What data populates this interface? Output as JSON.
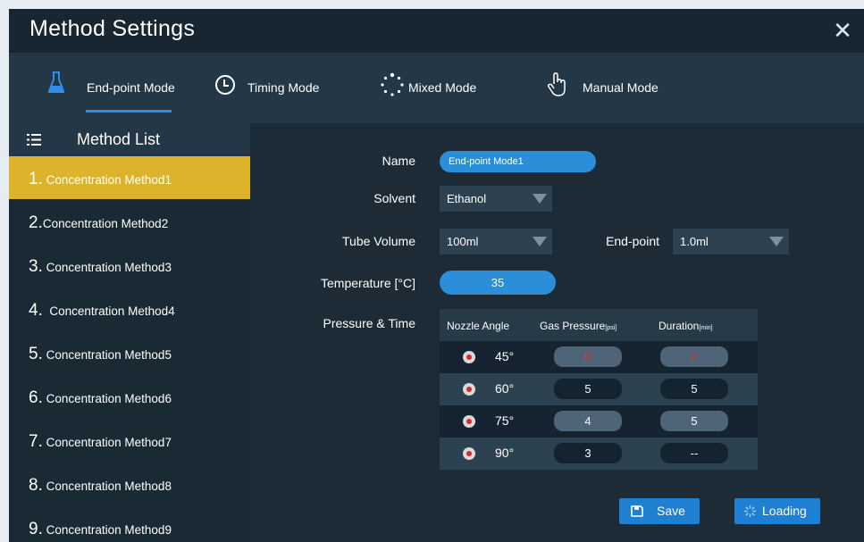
{
  "window": {
    "title": "Method Settings"
  },
  "modes": [
    {
      "label": "End-point Mode",
      "icon": "flask-icon",
      "active": true
    },
    {
      "label": "Timing Mode",
      "icon": "clock-icon",
      "active": false
    },
    {
      "label": "Mixed Mode",
      "icon": "dotted-circle-icon",
      "active": false
    },
    {
      "label": "Manual Mode",
      "icon": "hand-pointer-icon",
      "active": false
    }
  ],
  "sidebar": {
    "title": "Method List",
    "items": [
      {
        "num": "1.",
        "label": " Concentration Method1",
        "active": true
      },
      {
        "num": "2.",
        "label": "Concentration Method2",
        "active": false
      },
      {
        "num": "3.",
        "label": " Concentration Method3",
        "active": false
      },
      {
        "num": "4.",
        "label": "  Concentration Method4",
        "active": false
      },
      {
        "num": "5.",
        "label": " Concentration Method5",
        "active": false
      },
      {
        "num": "6.",
        "label": " Concentration Method6",
        "active": false
      },
      {
        "num": "7.",
        "label": " Concentration Method7",
        "active": false
      },
      {
        "num": "8.",
        "label": " Concentration Method8",
        "active": false
      },
      {
        "num": "9.",
        "label": " Concentration Method9",
        "active": false
      }
    ]
  },
  "form": {
    "name_label": "Name",
    "name_value": "End-point Mode1",
    "solvent_label": "Solvent",
    "solvent_value": "Ethanol",
    "tube_volume_label": "Tube Volume",
    "tube_volume_value": "100ml",
    "endpoint_label": "End-point",
    "endpoint_value": "1.0ml",
    "temperature_label": "Temperature [°C]",
    "temperature_value": "35",
    "pressure_time_label": "Pressure & Time"
  },
  "pressure_table": {
    "headers": {
      "angle": "Nozzle Angle",
      "gas_pressure": "Gas Pressure",
      "gas_unit": "[psi]",
      "duration": "Duration",
      "duration_unit": "[min]"
    },
    "rows": [
      {
        "angle": "45°",
        "gas": "0",
        "duration": "2"
      },
      {
        "angle": "60°",
        "gas": "5",
        "duration": "5"
      },
      {
        "angle": "75°",
        "gas": "4",
        "duration": "5"
      },
      {
        "angle": "90°",
        "gas": "3",
        "duration": "--"
      }
    ]
  },
  "buttons": {
    "save": "Save",
    "loading": "Loading"
  },
  "colors": {
    "accent": "#2f8ee6",
    "active_item": "#dcb32b",
    "error_value": "#e82e2e"
  }
}
